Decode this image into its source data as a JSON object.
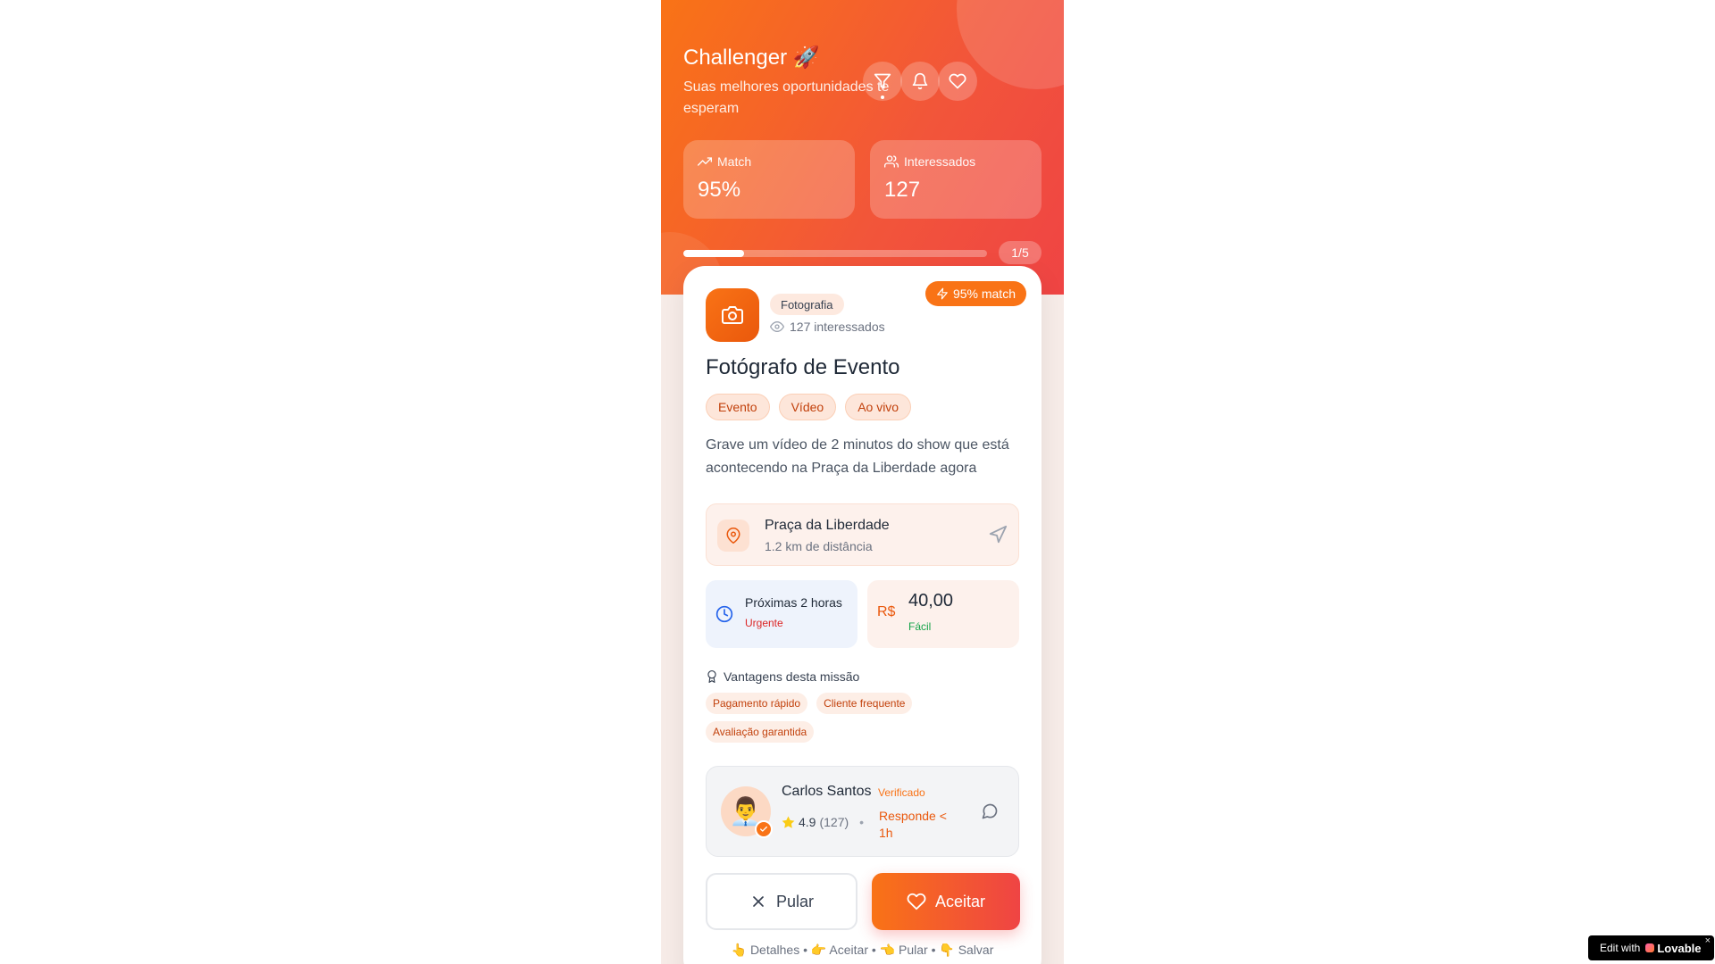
{
  "header": {
    "title": "Challenger 🚀",
    "subtitle": "Suas melhores oportunidades te esperam",
    "buttons": [
      "filter-icon",
      "bell-icon",
      "heart-icon"
    ]
  },
  "stats": [
    {
      "label": "Match",
      "value": "95%",
      "icon": "trending-up-icon"
    },
    {
      "label": "Interessados",
      "value": "127",
      "icon": "users-icon"
    }
  ],
  "progress": {
    "fraction": 0.2,
    "label": "1/5"
  },
  "card": {
    "match_badge": "95% match",
    "category": "Fotografia",
    "interested": "127 interessados",
    "title": "Fotógrafo de Evento",
    "tags": [
      "Evento",
      "Vídeo",
      "Ao vivo"
    ],
    "description": "Grave um vídeo de 2 minutos do show que está acontecendo na Praça da Liberdade agora",
    "location": {
      "name": "Praça da Liberdade",
      "distance": "1.2 km de distância"
    },
    "time": {
      "label": "Próximas 2 horas",
      "status": "Urgente"
    },
    "price": {
      "currency": "R$",
      "amount": "40,00",
      "difficulty": "Fácil"
    },
    "perks_title": "Vantagens desta missão",
    "perks": [
      "Pagamento rápido",
      "Cliente frequente",
      "Avaliação garantida"
    ],
    "client": {
      "avatar": "👨‍💼",
      "name": "Carlos Santos",
      "verified": "Verificado",
      "rating": "4.9",
      "reviews": "(127)",
      "response": "Responde < 1h"
    },
    "actions": {
      "skip": "Pular",
      "accept": "Aceitar"
    },
    "hint": "👆 Detalhes • 👉 Aceitar • 👈 Pular • 👇 Salvar"
  },
  "badge": {
    "prefix": "Edit with",
    "brand": "Lovable"
  },
  "colors": {
    "accent": "#f97316",
    "accent_end": "#ef4444",
    "urgent": "#dc2626",
    "easy": "#16a34a"
  }
}
